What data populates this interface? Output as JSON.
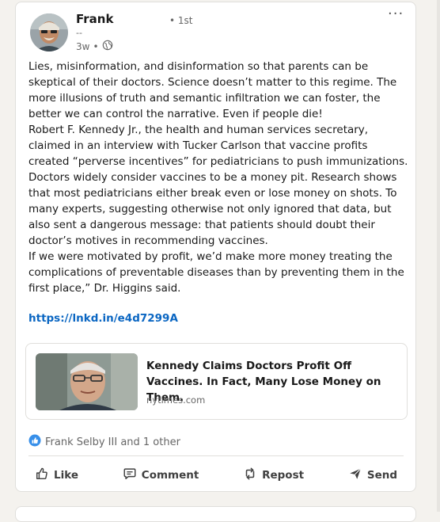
{
  "post": {
    "author": {
      "name": "Frank",
      "degree": "• 1st",
      "headline": "--",
      "time": "3w",
      "separator": "•",
      "visibility_icon": "globe-icon"
    },
    "menu_icon": "more-options-icon",
    "body_paragraphs": [
      "Lies, misinformation, and disinformation so that parents can be skeptical of their doctors. Science doesn’t matter to this regime. The more illusions of truth and semantic infiltration we can foster, the better we can control the narrative. Even if people die!",
      "Robert F. Kennedy Jr., the health and human services secretary, claimed in an interview with Tucker Carlson that vaccine profits created “perverse incentives” for pediatricians to push immunizations. Doctors widely consider vaccines to be a money pit. Research shows that most pediatricians either break even or lose money on shots. To many experts, suggesting otherwise not only ignored that data, but also sent a dangerous message: that patients should doubt their doctor’s motives in recommending vaccines.",
      "If we were motivated by profit, we’d make more money treating the complications of preventable diseases than by preventing them in the first place,” Dr. Higgins said."
    ],
    "link": "https://lnkd.in/e4d7299A",
    "preview": {
      "title": "Kennedy Claims Doctors Profit Off Vaccines. In Fact, Many Lose Money on Them.",
      "source": "nytimes.com"
    },
    "reactions": {
      "icon": "like-reaction-icon",
      "text": "Frank Selby III and 1 other"
    },
    "actions": [
      {
        "label": "Like",
        "icon": "thumbs-up-icon"
      },
      {
        "label": "Comment",
        "icon": "comment-icon"
      },
      {
        "label": "Repost",
        "icon": "repost-icon"
      },
      {
        "label": "Send",
        "icon": "send-icon"
      }
    ]
  },
  "colors": {
    "link": "#0a66c2",
    "text": "#191919",
    "muted": "#666666",
    "background": "#f4f2ee"
  }
}
